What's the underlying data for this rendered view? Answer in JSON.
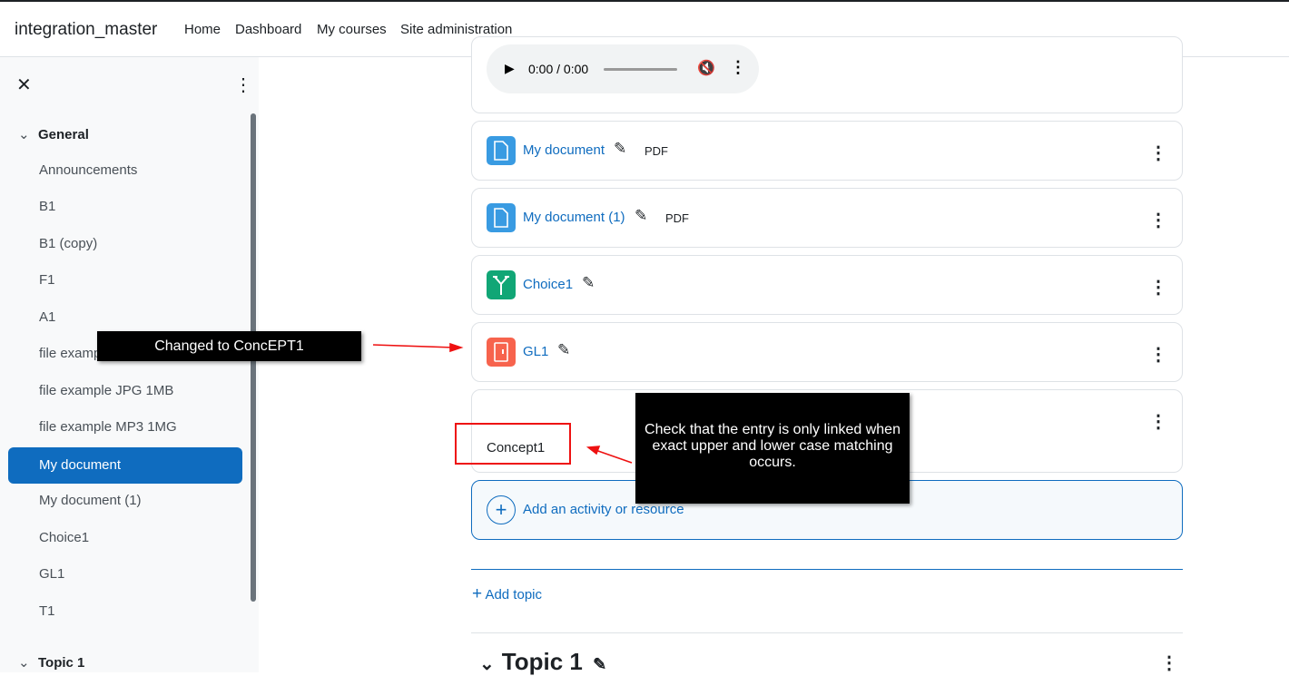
{
  "topbar": {
    "brand": "integration_master",
    "nav": [
      "Home",
      "Dashboard",
      "My courses",
      "Site administration"
    ]
  },
  "drawer": {
    "close_icon": "close-icon",
    "menu_icon": "kebab-icon",
    "section_general": "General",
    "items": [
      "Announcements",
      "B1",
      "B1 (copy)",
      "F1",
      "A1",
      "file example PDF 1MB",
      "file example JPG 1MB",
      "file example MP3 1MG",
      "My document",
      "My document (1)",
      "Choice1",
      "GL1",
      "T1"
    ],
    "active_item": "My document",
    "section_topic1": "Topic 1"
  },
  "audio": {
    "time": "0:00 / 0:00"
  },
  "activities": [
    {
      "name": "My document",
      "tag": "PDF",
      "icon": "file-icon",
      "color": "#399be2"
    },
    {
      "name": "My document (1)",
      "tag": "PDF",
      "icon": "file-icon",
      "color": "#399be2"
    },
    {
      "name": "Choice1",
      "tag": "",
      "icon": "choice-icon",
      "color": "#11a676"
    },
    {
      "name": "GL1",
      "tag": "",
      "icon": "glossary-icon",
      "color": "#f7634d"
    }
  ],
  "label_card": {
    "text": "Concept1"
  },
  "add_activity": "Add an activity or resource",
  "add_topic": "Add topic",
  "topic_title": "Topic 1",
  "annotations": {
    "left_note": "Changed to ConcEPT1",
    "right_note": "Check that the entry is only linked when exact upper and lower case matching occurs."
  },
  "colors": {
    "accent": "#0f6cbf",
    "annotation_red": "#e11111"
  }
}
